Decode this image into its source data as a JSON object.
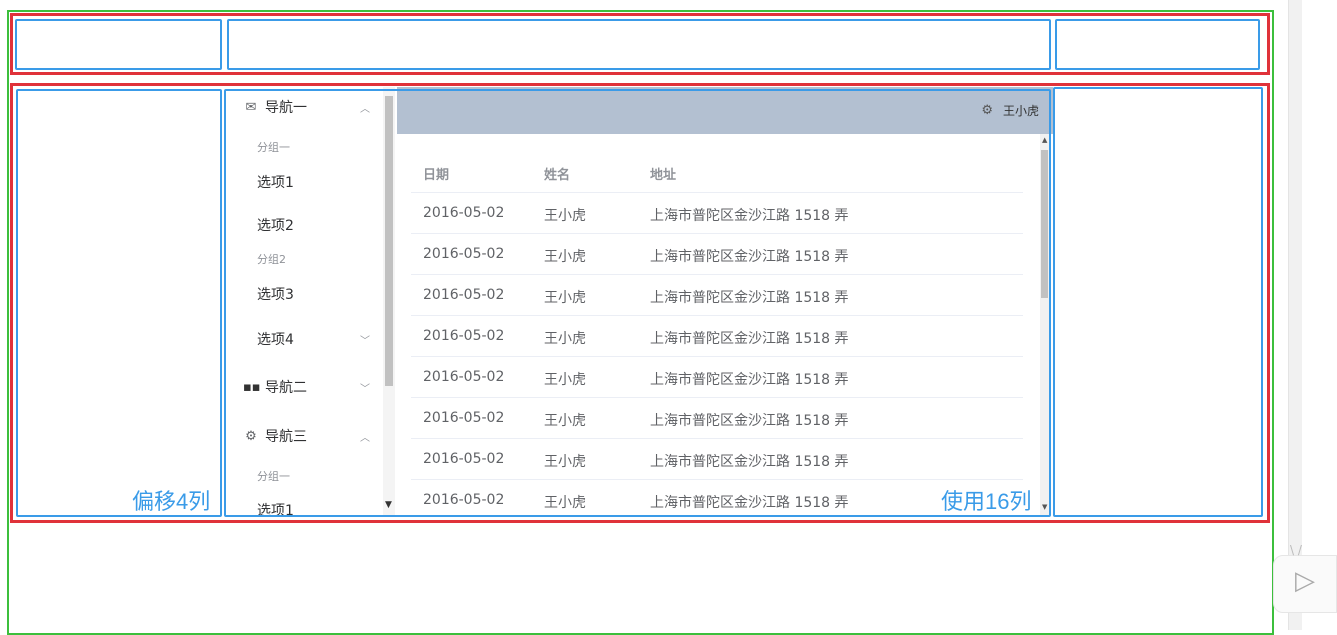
{
  "menu": {
    "nav1": {
      "label": "导航一",
      "icon": "message-icon"
    },
    "group1": "分组一",
    "option1": "选项1",
    "option2": "选项2",
    "group2": "分组2",
    "option3": "选项3",
    "option4": "选项4",
    "nav2": {
      "label": "导航二",
      "icon": "menu-grid-icon"
    },
    "nav3": {
      "label": "导航三",
      "icon": "setting-icon"
    },
    "group3": "分组一",
    "option5": "选项1"
  },
  "header": {
    "user": "王小虎",
    "gear_icon": "gear-icon"
  },
  "table": {
    "columns": [
      "日期",
      "姓名",
      "地址"
    ],
    "rows": [
      [
        "2016-05-02",
        "王小虎",
        "上海市普陀区金沙江路 1518 弄"
      ],
      [
        "2016-05-02",
        "王小虎",
        "上海市普陀区金沙江路 1518 弄"
      ],
      [
        "2016-05-02",
        "王小虎",
        "上海市普陀区金沙江路 1518 弄"
      ],
      [
        "2016-05-02",
        "王小虎",
        "上海市普陀区金沙江路 1518 弄"
      ],
      [
        "2016-05-02",
        "王小虎",
        "上海市普陀区金沙江路 1518 弄"
      ],
      [
        "2016-05-02",
        "王小虎",
        "上海市普陀区金沙江路 1518 弄"
      ],
      [
        "2016-05-02",
        "王小虎",
        "上海市普陀区金沙江路 1518 弄"
      ],
      [
        "2016-05-02",
        "王小虎",
        "上海市普陀区金沙江路 1518 弄"
      ]
    ]
  },
  "annotations": {
    "offset_label": "偏移4列",
    "use_label": "使用16列"
  },
  "colors": {
    "outer_frame": "#3cbf3c",
    "row_frame": "#e0323a",
    "col_frame": "#3a9be8",
    "header_bg": "#b3c0d1"
  }
}
